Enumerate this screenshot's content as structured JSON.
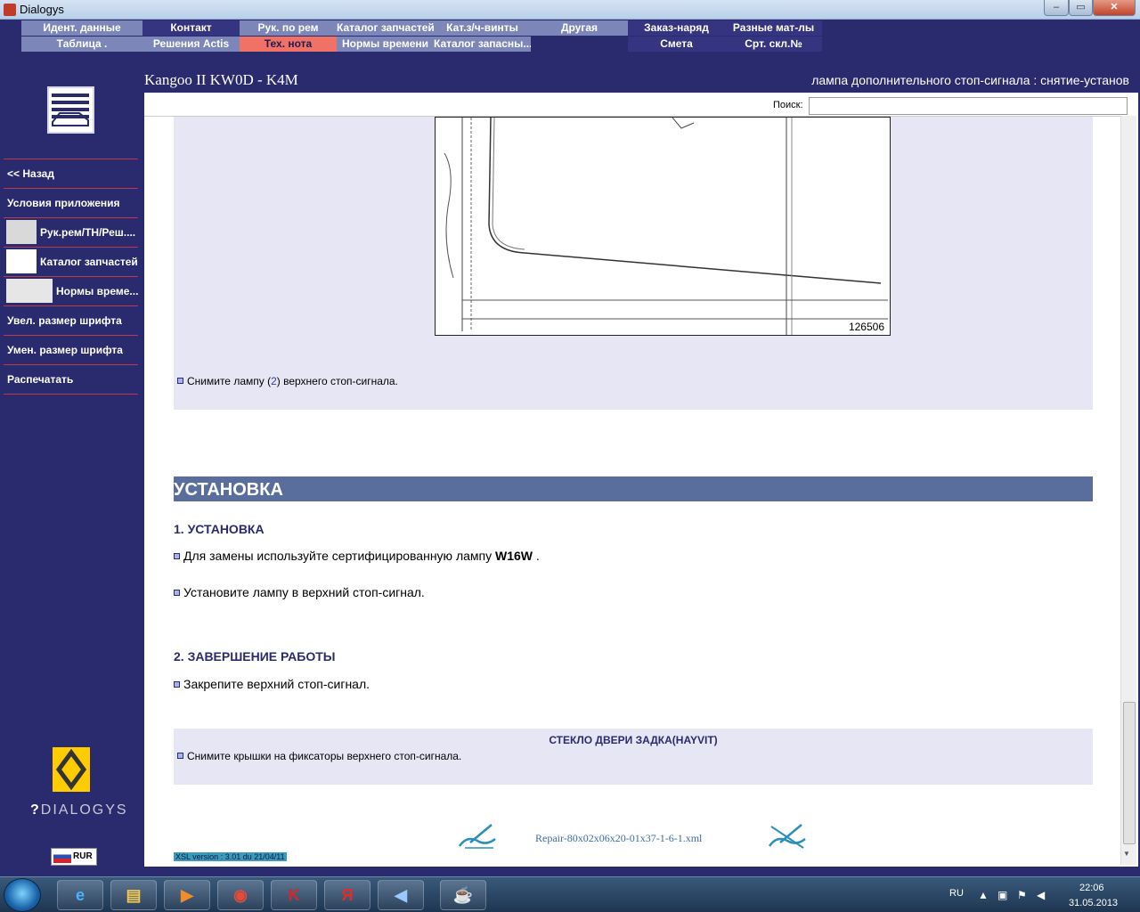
{
  "window": {
    "title": "Dialogys",
    "min": "–",
    "max": "▭",
    "close": "✕"
  },
  "nav": {
    "row1": [
      "Идент. данные",
      "Контакт",
      "Рук. по рем",
      "Каталог запчастей",
      "Кат.з/ч-винты",
      "Другая",
      "Заказ-наряд",
      "Разные мат-лы"
    ],
    "row2": [
      "Таблица .",
      "Решения Actis",
      "Тех. нота",
      "Нормы времени",
      "Каталог запасны...",
      "Смета",
      "Срт. скл.№"
    ],
    "active": "Тех. нота"
  },
  "header": {
    "vehicle": "Kangoo II KW0D - K4M",
    "doc_title": "лампа дополнительного стоп-сигнала : снятие-установ"
  },
  "sidebar": {
    "items": [
      "<< Назад",
      "Условия приложения",
      "Рук.рем/ТН/Реш....",
      "Каталог запчастей",
      "Нормы време...",
      "Увел. размер шрифта",
      "Умен. размер шрифта",
      "Распечатать"
    ],
    "brand": "DIALOGYS",
    "lang": "RUR"
  },
  "search": {
    "label": "Поиск:",
    "value": ""
  },
  "content": {
    "figure_number": "126506",
    "removal_step_pre": "Снимите лампу (",
    "removal_step_num": "2",
    "removal_step_post": ") верхнего стоп-сигнала.",
    "section_title": "УСТАНОВКА",
    "sub1": "1. УСТАНОВКА",
    "step1_pre": "Для замены используйте сертифицированную лампу ",
    "step1_bold": "W16W",
    "step1_post": " .",
    "step2": "Установите лампу в верхний стоп-сигнал.",
    "sub2": "2. ЗАВЕРШЕНИЕ РАБОТЫ",
    "step3": "Закрепите верхний стоп-сигнал.",
    "note_title": "СТЕКЛО ДВЕРИ ЗАДКА(HAYVIT)",
    "note_step": "Снимите крышки на фиксаторы верхнего стоп-сигнала.",
    "file": "Repair-80x02x06x20-01x37-1-6-1.xml",
    "xsl": "XSL version : 3.01 du 21/04/11"
  },
  "taskbar": {
    "lang": "RU",
    "time": "22:06",
    "date": "31.05.2013"
  },
  "colors": {
    "bg": "#2a2a6e",
    "nav_gray": "#7c86b8",
    "nav_active": "#f07266",
    "section": "#5a6e9e",
    "lavender": "#e6e6f5"
  }
}
